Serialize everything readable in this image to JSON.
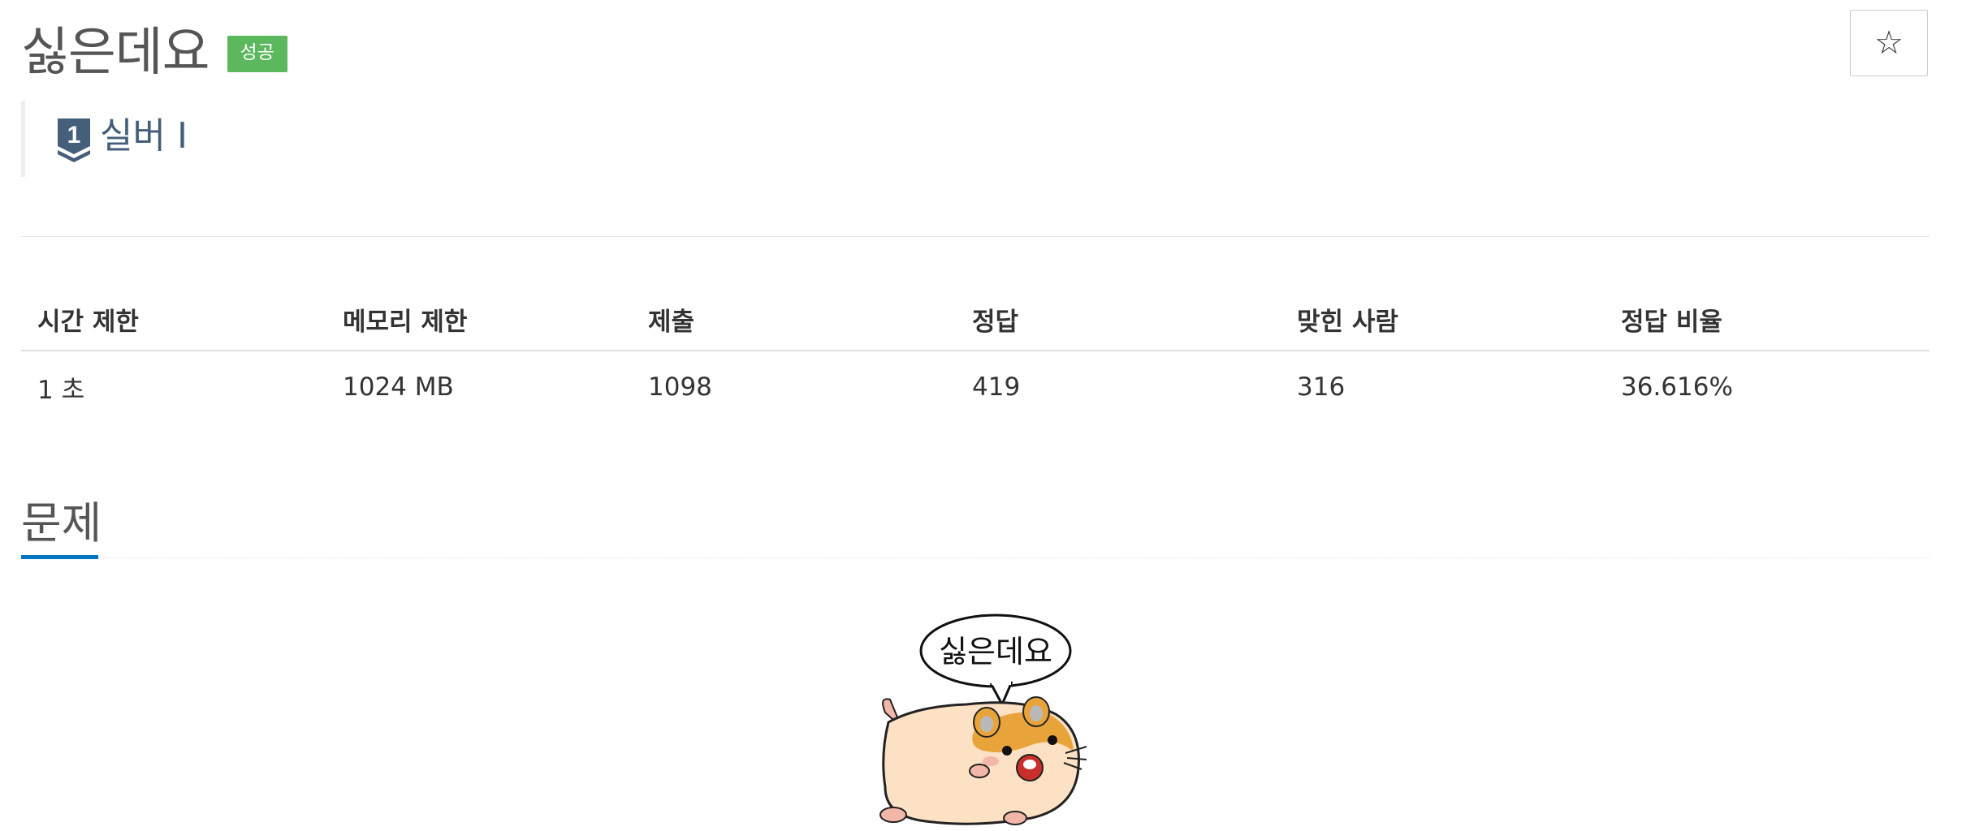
{
  "problem": {
    "title": "싫은데요",
    "status_badge": "성공",
    "star_label": "☆"
  },
  "tier": {
    "icon": "tier-silver-1-icon",
    "level_number": "1",
    "label": "실버 I",
    "color": "#435f7a"
  },
  "info_table": {
    "headers": [
      "시간 제한",
      "메모리 제한",
      "제출",
      "정답",
      "맞힌 사람",
      "정답 비율"
    ],
    "values": [
      "1 초",
      "1024 MB",
      "1098",
      "419",
      "316",
      "36.616%"
    ]
  },
  "section": {
    "title": "문제"
  },
  "illustration": {
    "icon": "hamster-icon",
    "speech_text": "싫은데요"
  },
  "colors": {
    "success": "#5cb85c",
    "accent": "#0076c0",
    "tier": "#435f7a"
  }
}
